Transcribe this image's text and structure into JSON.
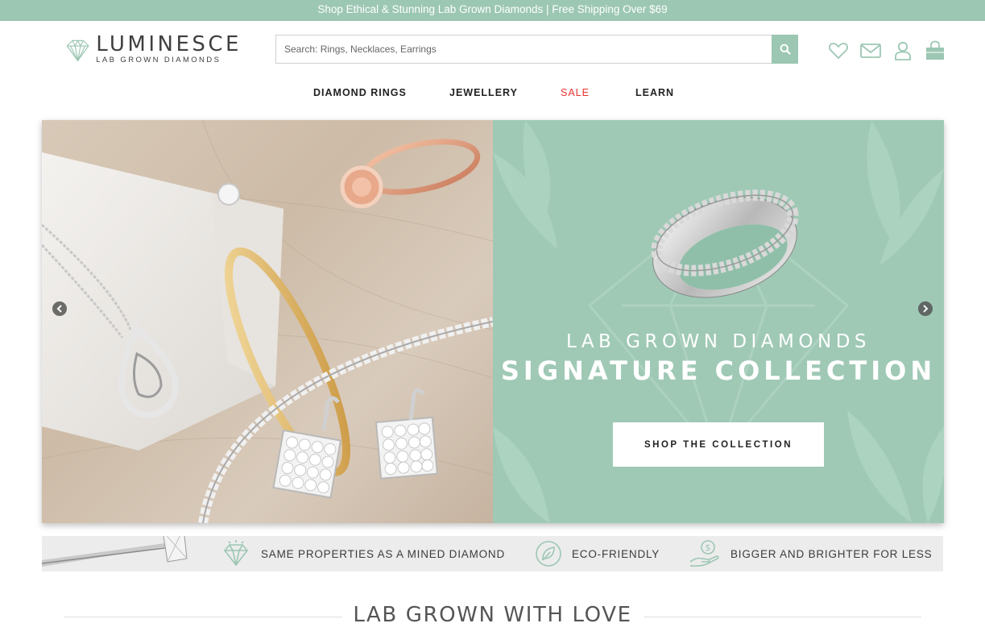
{
  "announcement": "Shop Ethical & Stunning Lab Grown Diamonds | Free Shipping Over $69",
  "brand": {
    "name": "LUMINESCE",
    "tagline": "LAB GROWN DIAMONDS",
    "logo_icon": "diamond-logo-icon"
  },
  "search": {
    "placeholder": "Search: Rings, Necklaces, Earrings",
    "icon": "search-icon"
  },
  "header_icons": [
    "heart-icon",
    "envelope-icon",
    "user-icon",
    "shopping-bag-icon"
  ],
  "nav": [
    {
      "label": "DIAMOND RINGS"
    },
    {
      "label": "JEWELLERY"
    },
    {
      "label": "SALE"
    },
    {
      "label": "LEARN"
    }
  ],
  "hero": {
    "subtitle": "LAB GROWN DIAMONDS",
    "title": "SIGNATURE COLLECTION",
    "cta": "SHOP THE COLLECTION"
  },
  "benefits": [
    {
      "icon": "diamond-icon",
      "label": "SAME PROPERTIES AS A MINED DIAMOND"
    },
    {
      "icon": "leaf-icon",
      "label": "ECO-FRIENDLY"
    },
    {
      "icon": "hand-money-icon",
      "label": "BIGGER AND BRIGHTER FOR LESS"
    }
  ],
  "section": {
    "title": "LAB GROWN WITH LOVE"
  },
  "colors": {
    "accent": "#9cc7b3",
    "sale": "#e8312e",
    "text": "#333333"
  }
}
